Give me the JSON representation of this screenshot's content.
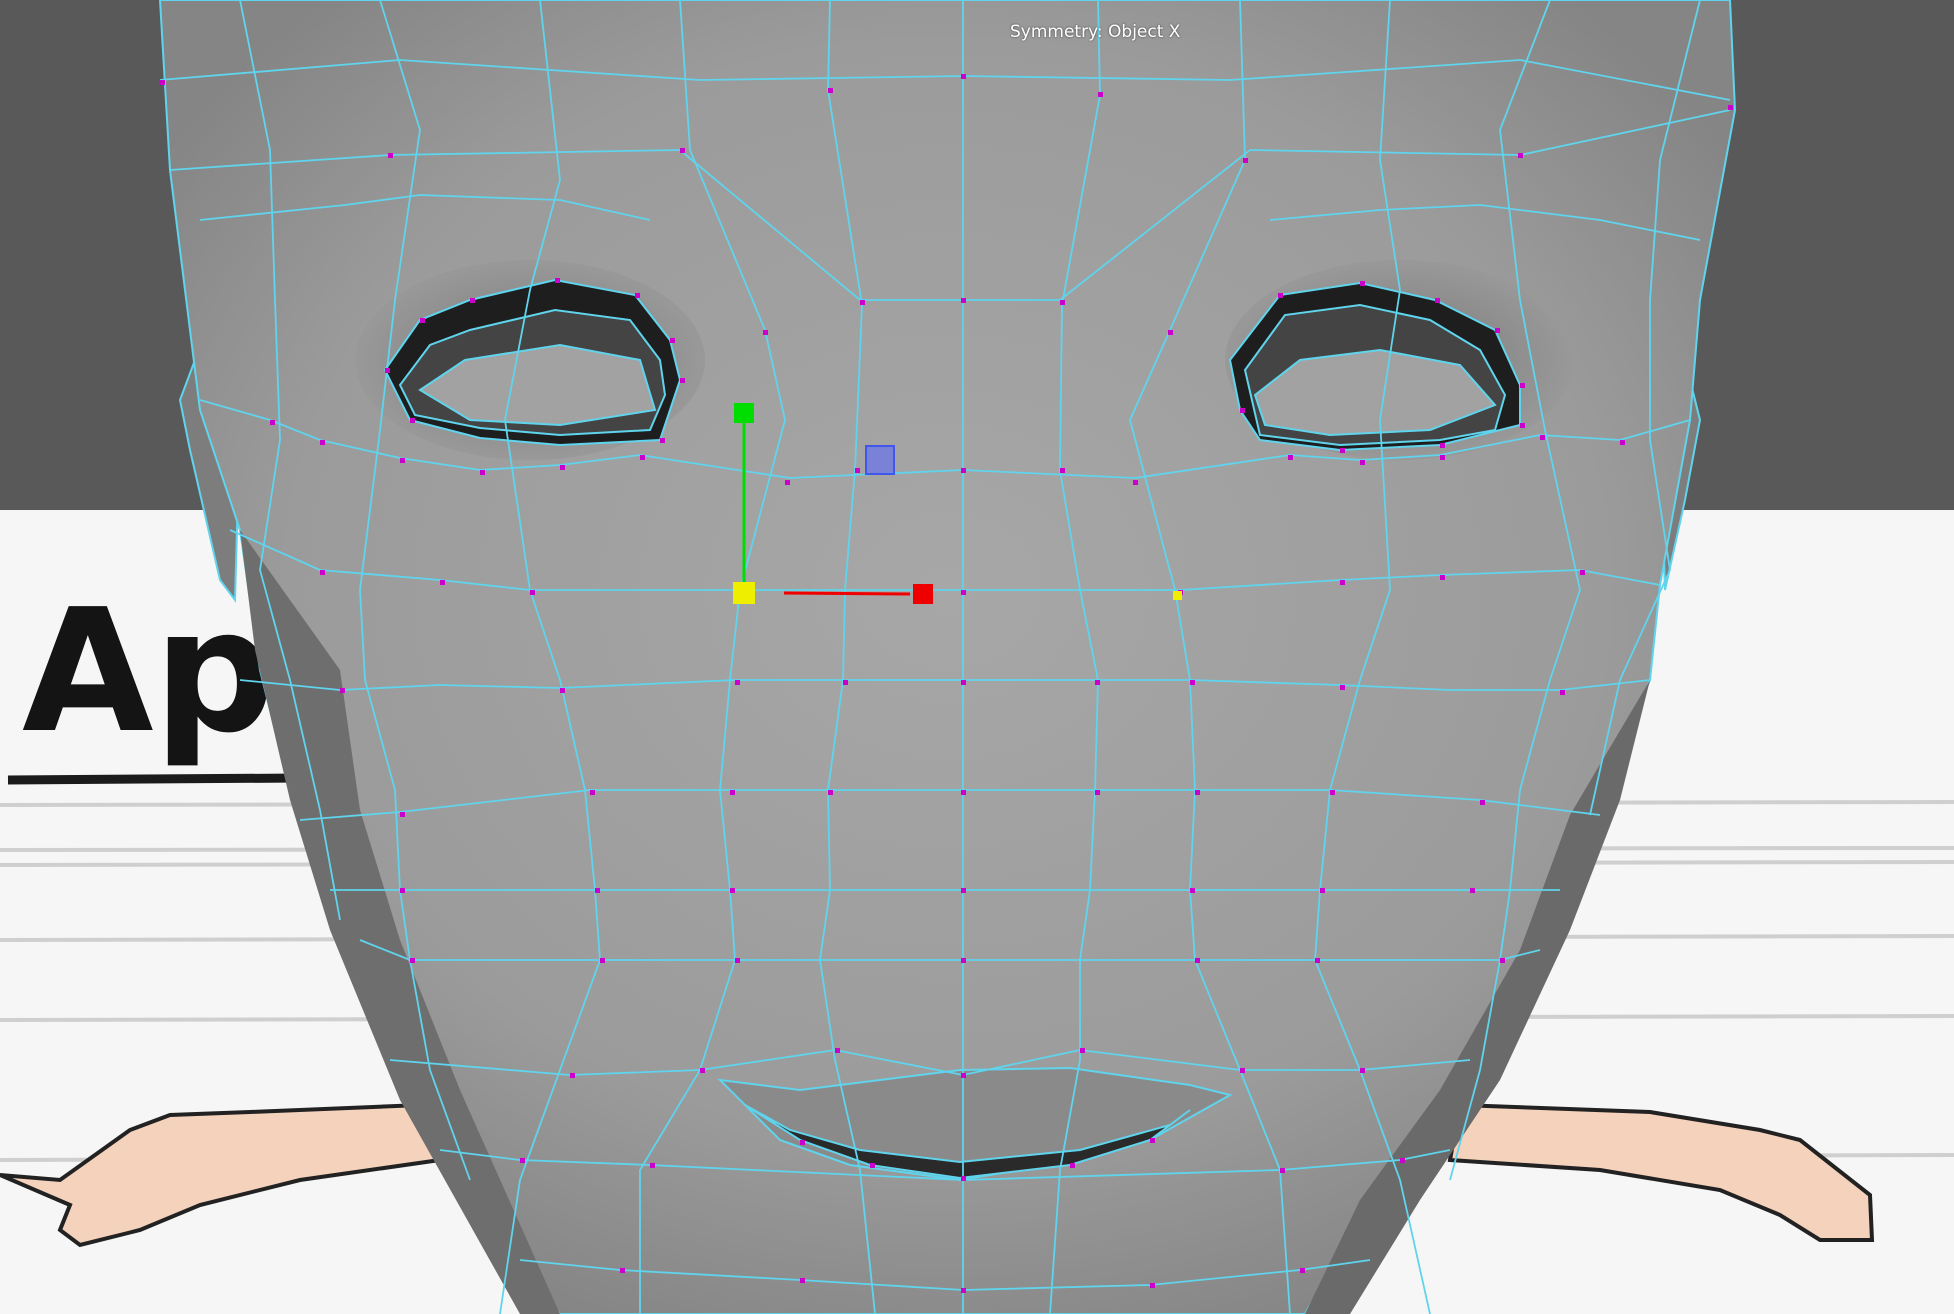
{
  "viewport": {
    "hud": {
      "symmetry_label": "Symmetry: Object X"
    },
    "image_plane": {
      "text": "Apr"
    }
  },
  "colors": {
    "background": "#595959",
    "paper": "#f6f6f6",
    "skin": "#f4d2bc",
    "wireframe": "#5fd4ec",
    "vertex": "#cc00cc",
    "mesh": "#9d9d9d",
    "manipulator_y": "#00dd00",
    "manipulator_x": "#ee0000",
    "manipulator_center": "#eeee00",
    "manipulator_plane": "#5566ff"
  },
  "icons": [
    "move-manipulator-icon",
    "symmetry-vertex-icon"
  ]
}
